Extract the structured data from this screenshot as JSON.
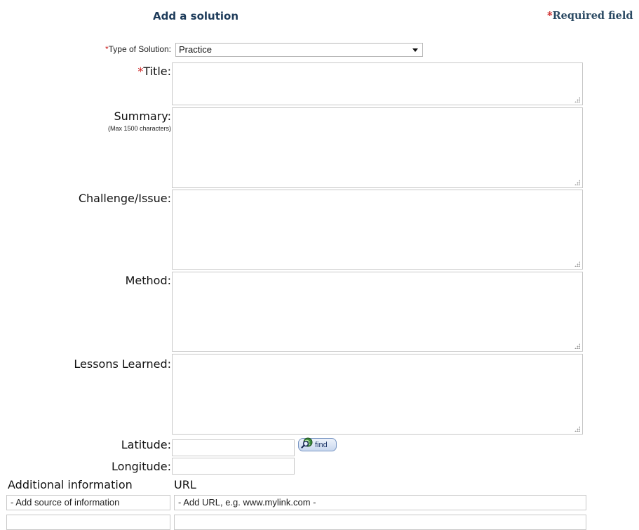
{
  "header": {
    "title": "Add a solution",
    "required_asterisk": "*",
    "required_label": "Required field"
  },
  "form": {
    "required_marker": "*",
    "type_of_solution": {
      "label": "Type of Solution:",
      "selected_value": "Practice"
    },
    "title": {
      "label": "Title:"
    },
    "summary": {
      "label": "Summary:",
      "hint": "(Max 1500 characters)"
    },
    "challenge": {
      "label": "Challenge/Issue:"
    },
    "method": {
      "label": "Method:"
    },
    "lessons": {
      "label": "Lessons Learned:"
    },
    "latitude": {
      "label": "Latitude:"
    },
    "longitude": {
      "label": "Longitude:"
    },
    "find_button": {
      "label": "find",
      "icon": "globe-magnifier-icon"
    }
  },
  "additional_info": {
    "headers": [
      "Additional information",
      "URL"
    ],
    "rows": [
      {
        "source_placeholder": "- Add source of information",
        "url_placeholder": "- Add URL, e.g. www.mylink.com -"
      },
      {
        "source_placeholder": "",
        "url_placeholder": ""
      }
    ]
  },
  "colors": {
    "heading": "#1d3b5a",
    "required_asterisk": "#cc2222",
    "field_border": "#c8c8c8",
    "button_border": "#7a97c4"
  }
}
